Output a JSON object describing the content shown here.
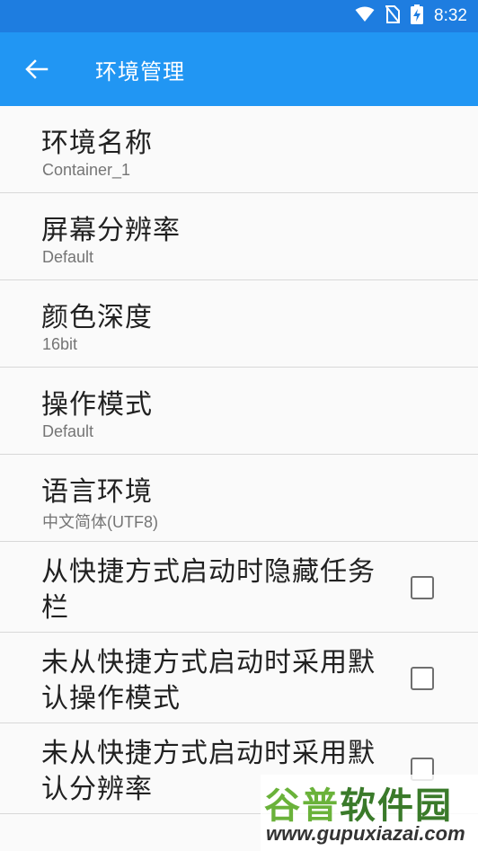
{
  "status_bar": {
    "time": "8:32",
    "icons": [
      "wifi-icon",
      "no-sim-icon",
      "battery-charging-icon"
    ]
  },
  "app_bar": {
    "back_icon": "arrow-left-icon",
    "title": "环境管理"
  },
  "settings": [
    {
      "title": "环境名称",
      "value": "Container_1"
    },
    {
      "title": "屏幕分辨率",
      "value": "Default"
    },
    {
      "title": "颜色深度",
      "value": "16bit"
    },
    {
      "title": "操作模式",
      "value": "Default"
    },
    {
      "title": "语言环境",
      "value": "中文简体(UTF8)"
    }
  ],
  "checkboxes": [
    {
      "label": "从快捷方式启动时隐藏任务栏",
      "checked": false
    },
    {
      "label": "未从快捷方式启动时采用默认操作模式",
      "checked": false
    },
    {
      "label": "未从快捷方式启动时采用默认分辨率",
      "checked": false
    }
  ],
  "watermark": {
    "text_a": "谷普",
    "text_b": "软件园",
    "url": "www.gupuxiazai.com"
  },
  "colors": {
    "status_bar": "#1e7de0",
    "app_bar": "#2196f3"
  }
}
